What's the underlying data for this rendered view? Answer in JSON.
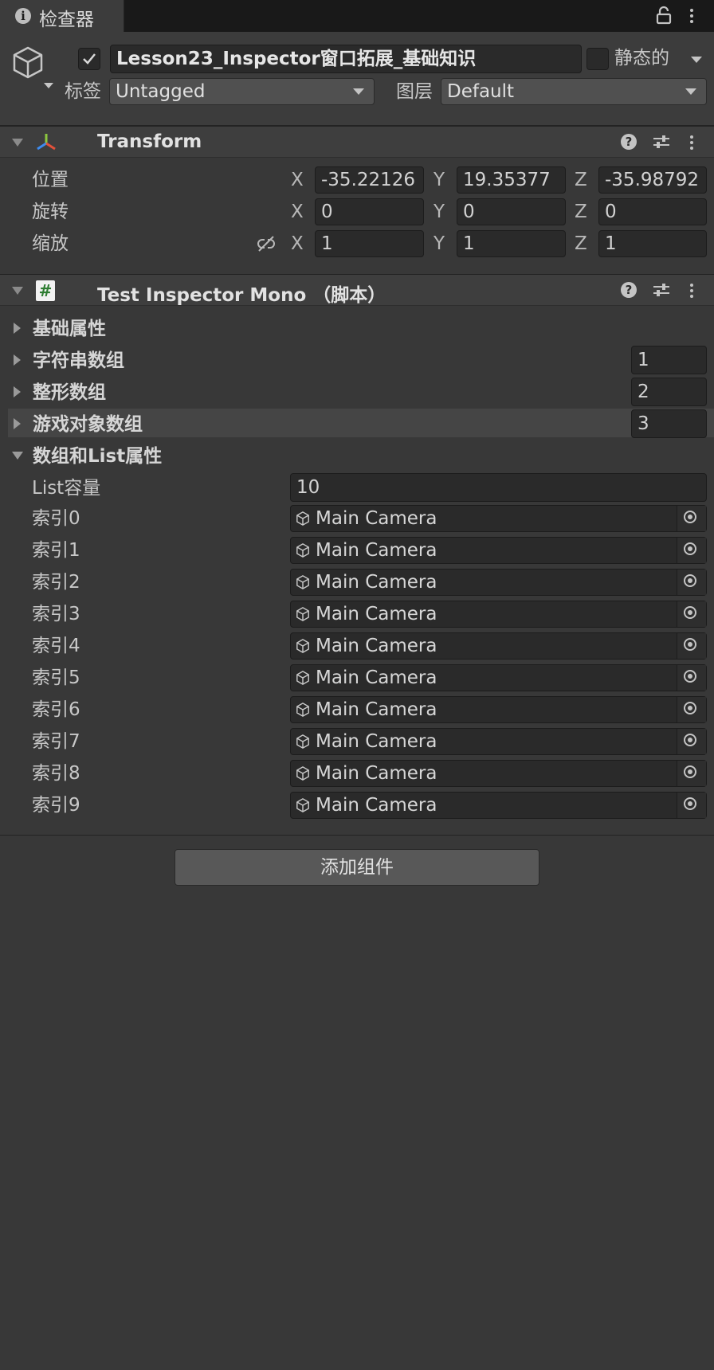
{
  "tab": {
    "title": "检查器",
    "info_icon": "info-icon",
    "lock_icon": "lock-icon",
    "menu_icon": "kebab-menu-icon"
  },
  "header": {
    "object_name": "Lesson23_Inspector窗口拓展_基础知识",
    "active_checked": true,
    "static_label": "静态的",
    "static_checked": false,
    "tag_label": "标签",
    "tag_value": "Untagged",
    "layer_label": "图层",
    "layer_value": "Default"
  },
  "transform": {
    "title": "Transform",
    "rows": [
      {
        "label": "位置",
        "x": "-35.22126",
        "y": "19.35377",
        "z": "-35.98792"
      },
      {
        "label": "旋转",
        "x": "0",
        "y": "0",
        "z": "0"
      },
      {
        "label": "缩放",
        "x": "1",
        "y": "1",
        "z": "1"
      }
    ],
    "axis": {
      "x": "X",
      "y": "Y",
      "z": "Z"
    }
  },
  "script_component": {
    "title": "Test Inspector Mono （脚本）",
    "icon_glyph": "#",
    "foldouts": [
      {
        "label": "基础属性",
        "count": ""
      },
      {
        "label": "字符串数组",
        "count": "1"
      },
      {
        "label": "整形数组",
        "count": "2"
      },
      {
        "label": "游戏对象数组",
        "count": "3"
      }
    ],
    "list_section": {
      "label": "数组和List属性",
      "capacity_label": "List容量",
      "capacity_value": "10",
      "items": [
        {
          "label": "索引0",
          "value": "Main Camera"
        },
        {
          "label": "索引1",
          "value": "Main Camera"
        },
        {
          "label": "索引2",
          "value": "Main Camera"
        },
        {
          "label": "索引3",
          "value": "Main Camera"
        },
        {
          "label": "索引4",
          "value": "Main Camera"
        },
        {
          "label": "索引5",
          "value": "Main Camera"
        },
        {
          "label": "索引6",
          "value": "Main Camera"
        },
        {
          "label": "索引7",
          "value": "Main Camera"
        },
        {
          "label": "索引8",
          "value": "Main Camera"
        },
        {
          "label": "索引9",
          "value": "Main Camera"
        }
      ]
    }
  },
  "add_component_label": "添加组件",
  "colors": {
    "background": "#383838",
    "field": "#2a2a2a",
    "transform_x": "#e2513a",
    "transform_y": "#8cc63f",
    "transform_z": "#3d8cf0",
    "script_icon_green": "#2e7d32"
  }
}
